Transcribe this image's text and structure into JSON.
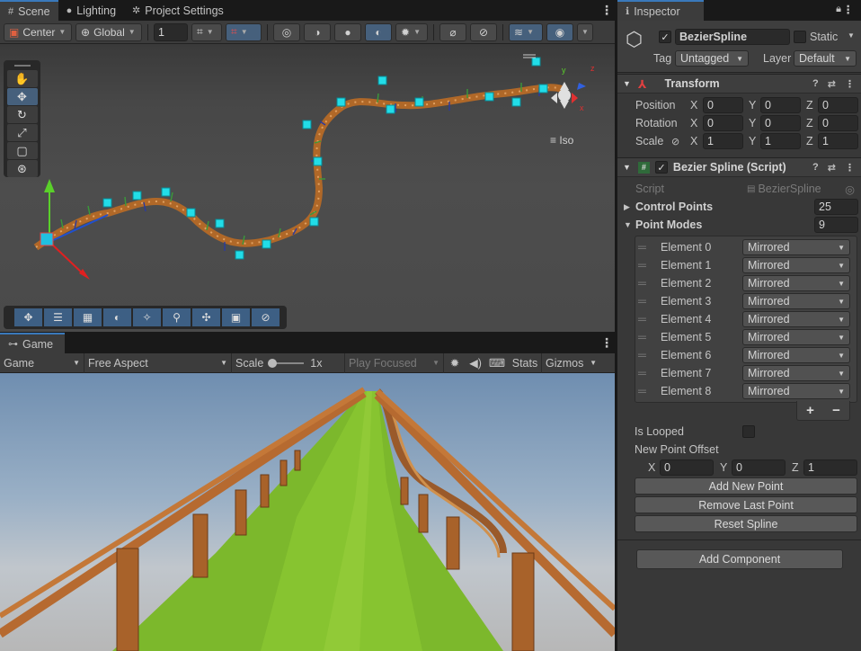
{
  "tabs": [
    {
      "label": "Scene",
      "icon": "grid-icon"
    },
    {
      "label": "Lighting",
      "icon": "bulb-icon"
    },
    {
      "label": "Project Settings",
      "icon": "gear-icon"
    }
  ],
  "scene_toolbar": {
    "pivot": "Center",
    "space": "Global",
    "grid_step": "1"
  },
  "scene": {
    "view_mode": "Iso"
  },
  "game_tab": {
    "label": "Game"
  },
  "game_toolbar": {
    "display": "Game",
    "aspect": "Free Aspect",
    "scale_label": "Scale",
    "scale_value": "1x",
    "play_mode": "Play Focused",
    "stats": "Stats",
    "gizmos": "Gizmos"
  },
  "inspector": {
    "tab": "Inspector",
    "object_name": "BezierSpline",
    "static_label": "Static",
    "tag_label": "Tag",
    "tag_value": "Untagged",
    "layer_label": "Layer",
    "layer_value": "Default",
    "transform": {
      "title": "Transform",
      "rows": [
        {
          "label": "Position",
          "x": "0",
          "y": "0",
          "z": "0"
        },
        {
          "label": "Rotation",
          "x": "0",
          "y": "0",
          "z": "0"
        },
        {
          "label": "Scale",
          "x": "1",
          "y": "1",
          "z": "1"
        }
      ],
      "axis_x": "X",
      "axis_y": "Y",
      "axis_z": "Z"
    },
    "script_component": {
      "title": "Bezier Spline (Script)",
      "script_label": "Script",
      "script_value": "BezierSpline",
      "control_points_label": "Control Points",
      "control_points_value": "25",
      "point_modes_label": "Point Modes",
      "point_modes_value": "9",
      "elements": [
        {
          "label": "Element 0",
          "value": "Mirrored"
        },
        {
          "label": "Element 1",
          "value": "Mirrored"
        },
        {
          "label": "Element 2",
          "value": "Mirrored"
        },
        {
          "label": "Element 3",
          "value": "Mirrored"
        },
        {
          "label": "Element 4",
          "value": "Mirrored"
        },
        {
          "label": "Element 5",
          "value": "Mirrored"
        },
        {
          "label": "Element 6",
          "value": "Mirrored"
        },
        {
          "label": "Element 7",
          "value": "Mirrored"
        },
        {
          "label": "Element 8",
          "value": "Mirrored"
        }
      ],
      "add_symbol": "+",
      "remove_symbol": "−",
      "is_looped_label": "Is Looped",
      "new_point_offset_label": "New Point Offset",
      "offset": {
        "x": "0",
        "y": "0",
        "z": "1"
      },
      "add_point_button": "Add New Point",
      "remove_point_button": "Remove Last Point",
      "reset_button": "Reset Spline"
    },
    "add_component_button": "Add Component"
  }
}
